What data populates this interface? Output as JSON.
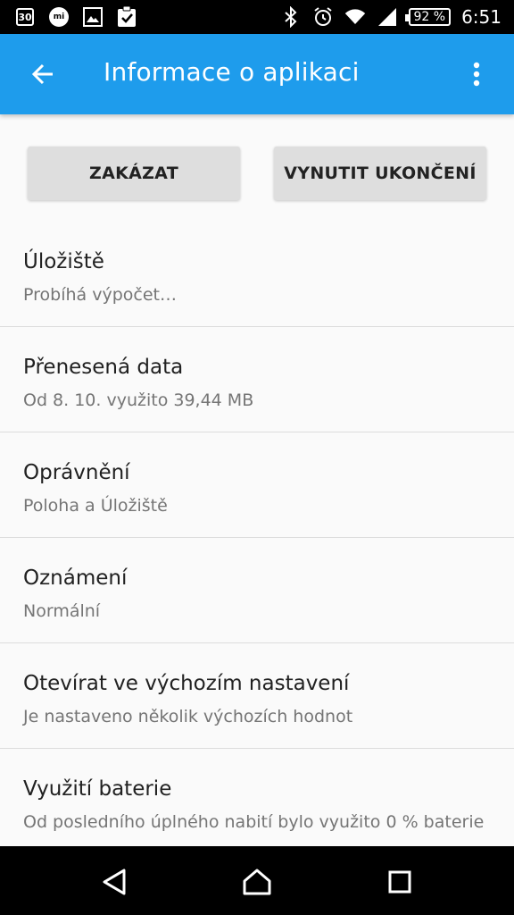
{
  "status_bar": {
    "calendar_day": "30",
    "mi_label": "mi",
    "battery": "92 %",
    "time": "6:51",
    "icons_left": [
      "calendar-icon",
      "mi-icon",
      "image-icon",
      "clipboard-check-icon"
    ],
    "icons_right": [
      "bluetooth-icon",
      "alarm-icon",
      "wifi-icon",
      "signal-icon",
      "battery-icon"
    ]
  },
  "app_bar": {
    "title": "Informace o aplikaci",
    "color": "#1e9cec"
  },
  "actions": {
    "disable_label": "ZAKÁZAT",
    "force_stop_label": "VYNUTIT UKONČENÍ"
  },
  "items": [
    {
      "title": "Úložiště",
      "subtitle": "Probíhá výpočet…"
    },
    {
      "title": "Přenesená data",
      "subtitle": "Od 8. 10. využito 39,44 MB"
    },
    {
      "title": "Oprávnění",
      "subtitle": "Poloha a Úložiště"
    },
    {
      "title": "Oznámení",
      "subtitle": "Normální"
    },
    {
      "title": "Otevírat ve výchozím nastavení",
      "subtitle": "Je nastaveno několik výchozích hodnot"
    },
    {
      "title": "Využití baterie",
      "subtitle": "Od posledního úplného nabití bylo využito 0 % baterie"
    }
  ],
  "nav_bar": {
    "buttons": [
      "back-triangle-icon",
      "home-icon",
      "recents-icon"
    ]
  }
}
